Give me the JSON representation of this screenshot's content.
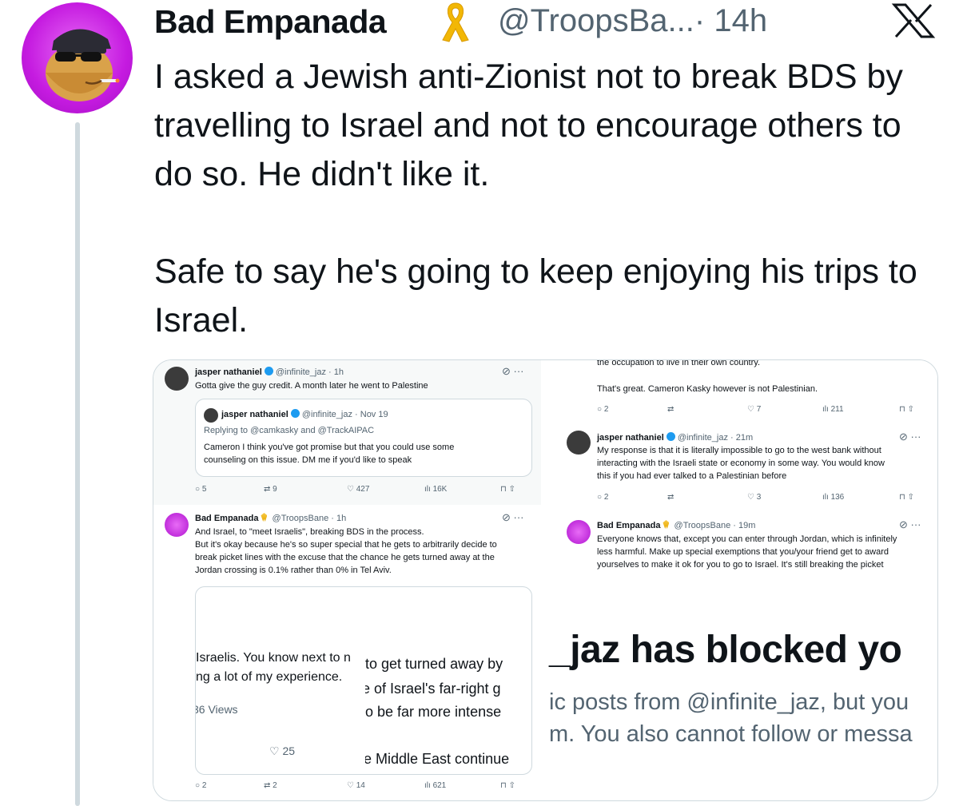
{
  "author": {
    "name": "Bad Empanada",
    "handle": "@TroopsBa...",
    "time": "· 14h"
  },
  "tweet": {
    "paragraph1": "I asked a Jewish anti-Zionist not to break BDS by travelling to Israel and not to encourage others to do so. He didn't like it.",
    "paragraph2": "Safe to say he's going to keep enjoying his trips to Israel."
  },
  "icons": {
    "brand": "x-logo-icon",
    "badge": "yellow-ribbon-icon",
    "verified": "verified-badge-icon"
  },
  "colors": {
    "avatar_bg": "#c51be0",
    "verified": "#1d9bf0",
    "ribbon": "#f2b705",
    "thread_line": "#cfd9de"
  },
  "screenshot_top_left": {
    "name": "jasper nathaniel",
    "handle": "@infinite_jaz · 1h",
    "text": "Gotta give the guy credit. A month later he went to Palestine",
    "quote": {
      "name": "jasper nathaniel",
      "handle": "@infinite_jaz · Nov 19",
      "replying": "Replying to @camkasky and @TrackAIPAC",
      "line1": "Cameron I think you've got promise but that you could use some",
      "line2": "counseling on this issue. DM me if you'd like to speak"
    },
    "stats": {
      "replies": "5",
      "reposts": "9",
      "likes": "427",
      "views": "16K"
    }
  },
  "screenshot_bottom_left": {
    "name": "Bad Empanada",
    "handle": "@TroopsBane · 1h",
    "line1": "And Israel, to \"meet Israelis\", breaking BDS in the process.",
    "line2": "But it's okay because he's so super special that he gets to arbitrarily decide to",
    "line3": "break picket lines with the excuse that the chance he gets turned away at the",
    "line4": "Jordan crossing is 0.1% rather than 0% in Tel Aviv.",
    "crop_a1": "Israelis. You know next to n",
    "crop_a2": "ng a lot of my experience.",
    "crop_a3": "36 Views",
    "crop_a4": "25",
    "crop_b1": "to get turned away by",
    "crop_b2": "e of Israel's far-right g",
    "crop_b3": "o be far more intense",
    "crop_b4": "e Middle East continue",
    "stats": {
      "replies": "2",
      "reposts": "2",
      "likes": "14",
      "views": "621"
    }
  },
  "screenshot_top_right": {
    "cut_line": "the occupation to live in their own country.",
    "text": "That's great. Cameron Kasky however is not Palestinian.",
    "stats1": {
      "replies": "2",
      "likes": "7",
      "views": "211"
    },
    "reply_name": "jasper nathaniel",
    "reply_handle": "@infinite_jaz · 21m",
    "reply_line1": "My response is that it is literally impossible to go to the west bank without",
    "reply_line2": "interacting with the Israeli state or economy in some way. You would know",
    "reply_line3": "this if you had ever talked to a Palestinian before",
    "stats2": {
      "replies": "2",
      "likes": "3",
      "views": "136"
    },
    "be_name": "Bad Empanada",
    "be_handle": "@TroopsBane · 19m",
    "be_line1": "Everyone knows that, except you can enter through Jordan, which is infinitely",
    "be_line2": "less harmful. Make up special exemptions that you/your friend get to award",
    "be_line3": "yourselves to make it ok for you to go to Israel. It's still breaking the picket"
  },
  "screenshot_bottom_right": {
    "headline": "_jaz has blocked yo",
    "sub1": "ic posts from @infinite_jaz, but you",
    "sub2": "m. You also cannot follow or messa"
  }
}
